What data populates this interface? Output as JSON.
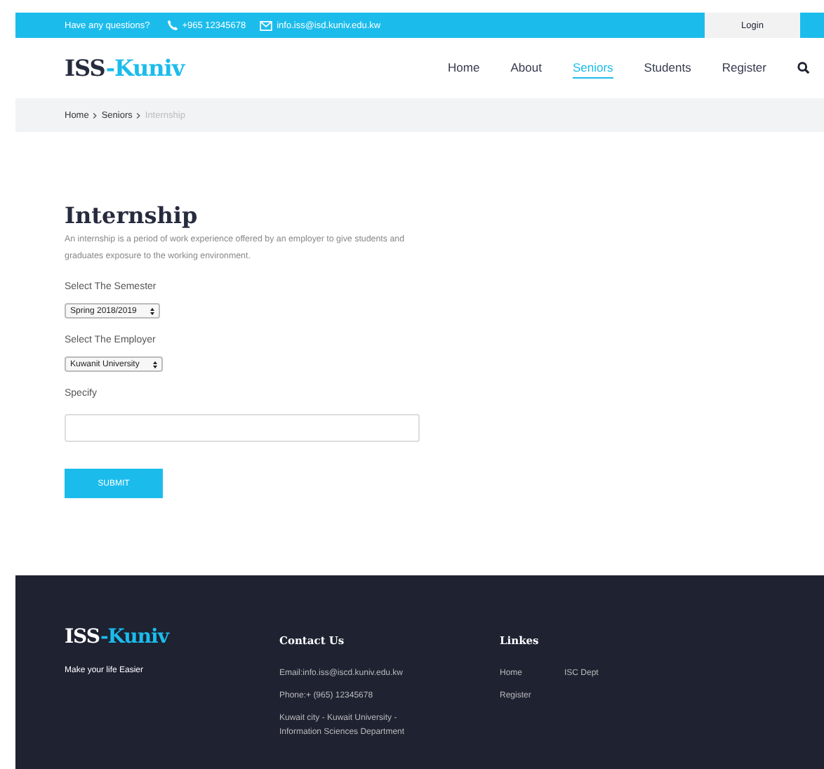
{
  "topbar": {
    "question": "Have any questions?",
    "phone": "+965 12345678",
    "email": "info.iss@isd.kuniv.edu.kw",
    "login": "Login"
  },
  "header": {
    "logo": {
      "main": "ISS",
      "accent": "-Kuniv"
    },
    "nav": [
      {
        "label": "Home",
        "selected": false
      },
      {
        "label": "About",
        "selected": false
      },
      {
        "label": "Seniors",
        "selected": true
      },
      {
        "label": "Students",
        "selected": false
      },
      {
        "label": "Register",
        "selected": false
      }
    ]
  },
  "breadcrumb": [
    "Home",
    "Seniors",
    "Internship"
  ],
  "page": {
    "title": "Internship",
    "description": "An internship is a period of work experience offered by an employer to give students and graduates exposure to the working environment.",
    "fields": [
      {
        "kind": "select",
        "label": "Select The Semester",
        "value": "Spring 2018/2019"
      },
      {
        "kind": "select",
        "label": "Select The Employer",
        "value": "Kuwanit University"
      },
      {
        "kind": "text",
        "label": "Specify"
      }
    ],
    "submit": "SUBMIT"
  },
  "footer": {
    "logo": {
      "main": "ISS",
      "accent": "-Kuniv"
    },
    "tagline": "Make your life Easier",
    "contact": {
      "title": "Contact Us",
      "lines": [
        "Email:info.iss@iscd.kuniv.edu.kw",
        "Phone:+ (965) 12345678",
        "Kuwait city - Kuwait University - Information Sciences Department"
      ]
    },
    "links": {
      "title": "Linkes",
      "items": [
        "Home",
        "ISC Dept",
        "Register"
      ]
    }
  }
}
